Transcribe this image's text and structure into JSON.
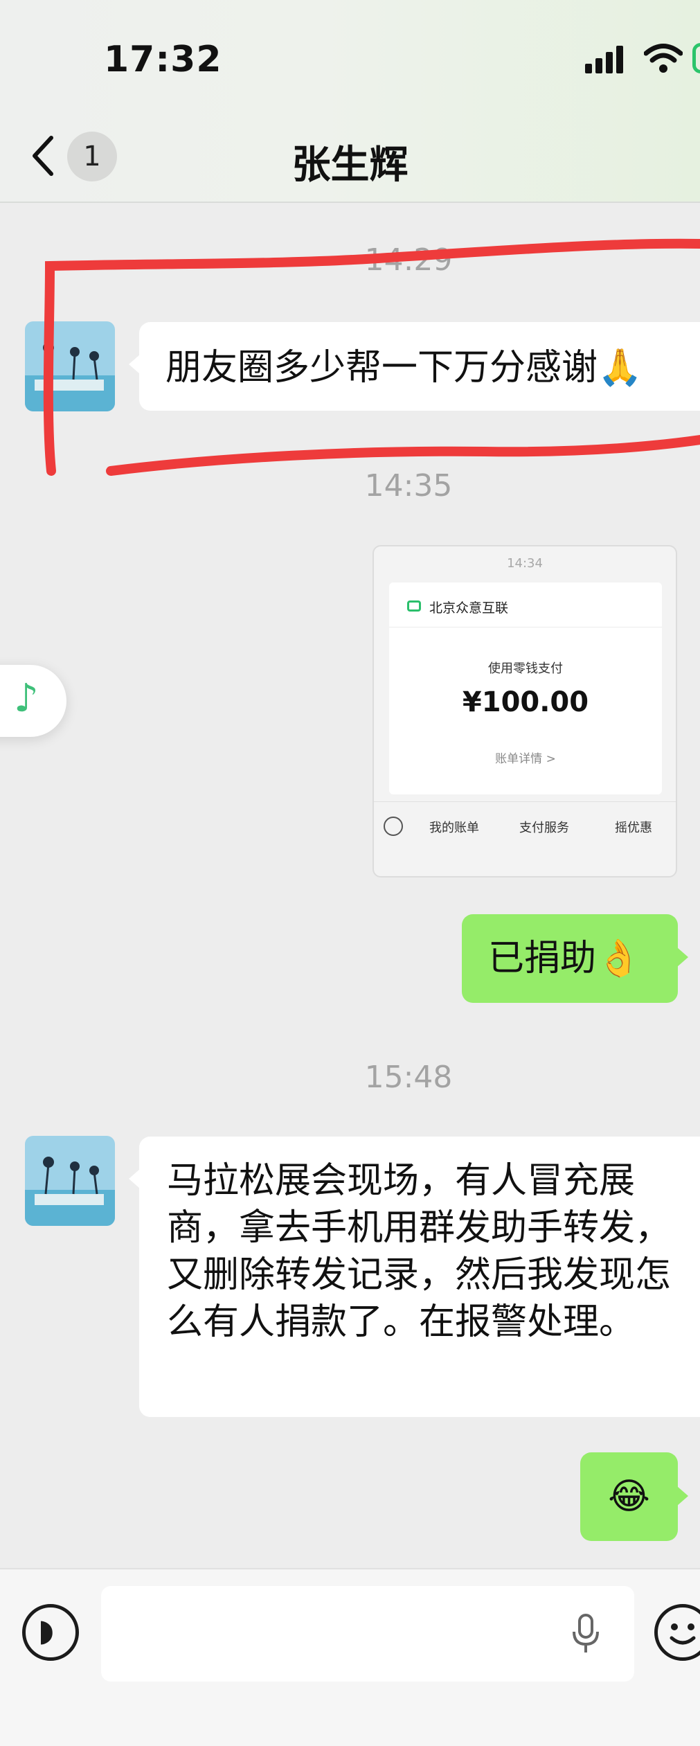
{
  "status_bar": {
    "time": "17:32"
  },
  "nav": {
    "back_badge": "1",
    "title": "张生辉"
  },
  "messages": [
    {
      "timestamp": "14:29"
    },
    {
      "sender": "contact",
      "text": "朋友圈多少帮一下万分感谢🙏"
    },
    {
      "timestamp": "14:35"
    },
    {
      "sender": "me",
      "type": "payment_screenshot",
      "card": {
        "time": "14:34",
        "merchant": "北京众意互联",
        "method": "使用零钱支付",
        "amount": "¥100.00",
        "detail_link": "账单详情 >",
        "actions": [
          "我的账单",
          "支付服务",
          "摇优惠"
        ]
      }
    },
    {
      "sender": "me",
      "text": "已捐助👌"
    },
    {
      "timestamp": "15:48"
    },
    {
      "sender": "contact",
      "text": "马拉松展会现场，有人冒充展商，拿去手机用群发助手转发，又删除转发记录，然后我发现怎么有人捐款了。在报警处理。"
    },
    {
      "sender": "me",
      "text": "😂"
    }
  ],
  "floating_music": {
    "icon": "music-note-icon",
    "glyph": "♪"
  },
  "bottom_bar": {
    "voice_icon": "voice-icon",
    "mic_icon": "mic-icon",
    "emoji_icon": "emoji-icon"
  },
  "colors": {
    "outgoing_bubble": "#95ec69",
    "incoming_bubble": "#ffffff",
    "background": "#ededed",
    "annotation": "#ee3b3b"
  }
}
